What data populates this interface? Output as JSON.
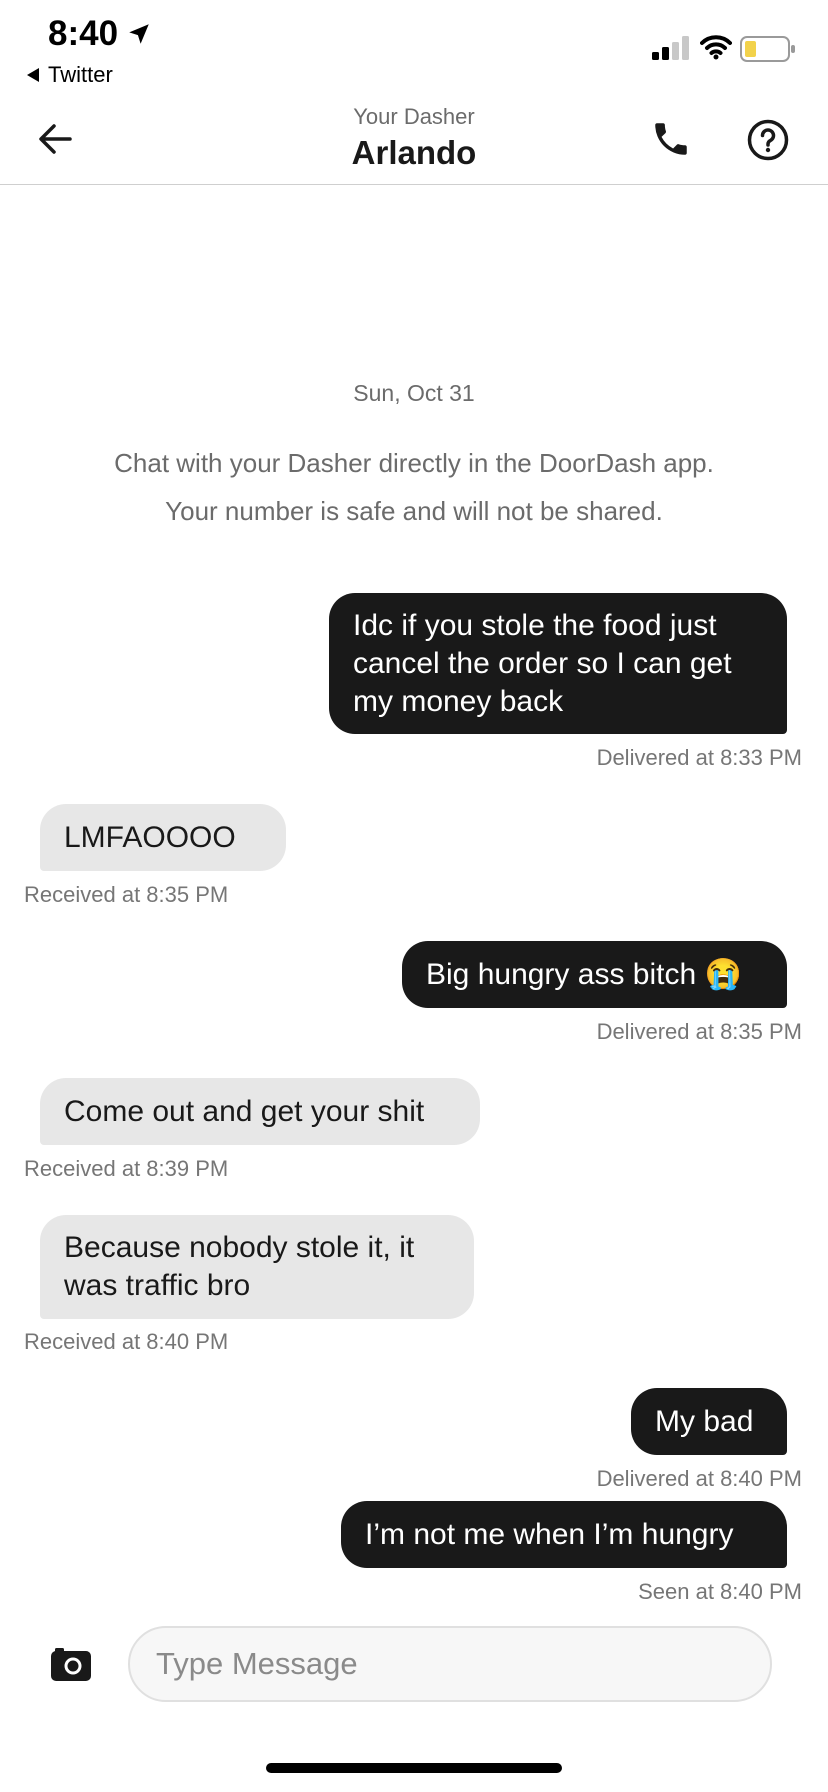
{
  "status_bar": {
    "time": "8:40",
    "back_app": "Twitter",
    "colors": {
      "battery_fill": "#f2d24b"
    },
    "icons": {
      "location": "location-arrow-icon",
      "signal": "signal-icon",
      "wifi": "wifi-icon",
      "battery": "battery-icon",
      "back_caret": "caret-left-icon"
    }
  },
  "header": {
    "subtitle": "Your Dasher",
    "title": "Arlando",
    "icons": {
      "back": "arrow-left-icon",
      "phone": "phone-icon",
      "help": "help-circle-icon"
    }
  },
  "chat": {
    "date": "Sun, Oct 31",
    "info_line1": "Chat with your Dasher directly in the DoorDash app.",
    "info_line2": "Your number is safe and will not be shared.",
    "messages": [
      {
        "direction": "outgoing",
        "text": "Idc if you stole the food just cancel the order so I can get my money back",
        "lines": [
          "Idc if you stole the food just",
          "cancel the order so I can get",
          "my money back"
        ],
        "status": "Delivered at 8:33 PM"
      },
      {
        "direction": "incoming",
        "text": "LMFAOOOO",
        "status": "Received at 8:35 PM"
      },
      {
        "direction": "outgoing",
        "text": "Big hungry ass bitch 😭",
        "status": "Delivered at 8:35 PM"
      },
      {
        "direction": "incoming",
        "text": "Come out and get your shit",
        "status": "Received at 8:39 PM"
      },
      {
        "direction": "incoming",
        "text": "Because nobody stole it, it was traffic bro",
        "lines": [
          "Because nobody stole it, it",
          "was traffic bro"
        ],
        "status": "Received at 8:40 PM"
      },
      {
        "direction": "outgoing",
        "text": "My bad",
        "status": "Delivered at 8:40 PM"
      },
      {
        "direction": "outgoing",
        "text": "I’m not me when I’m hungry",
        "status": "Seen at 8:40 PM"
      }
    ]
  },
  "composer": {
    "placeholder": "Type Message",
    "value": "",
    "icons": {
      "camera": "camera-icon"
    }
  },
  "colors": {
    "outgoing_bubble": "#191919",
    "incoming_bubble": "#e7e7e7",
    "meta_text": "#767676"
  }
}
